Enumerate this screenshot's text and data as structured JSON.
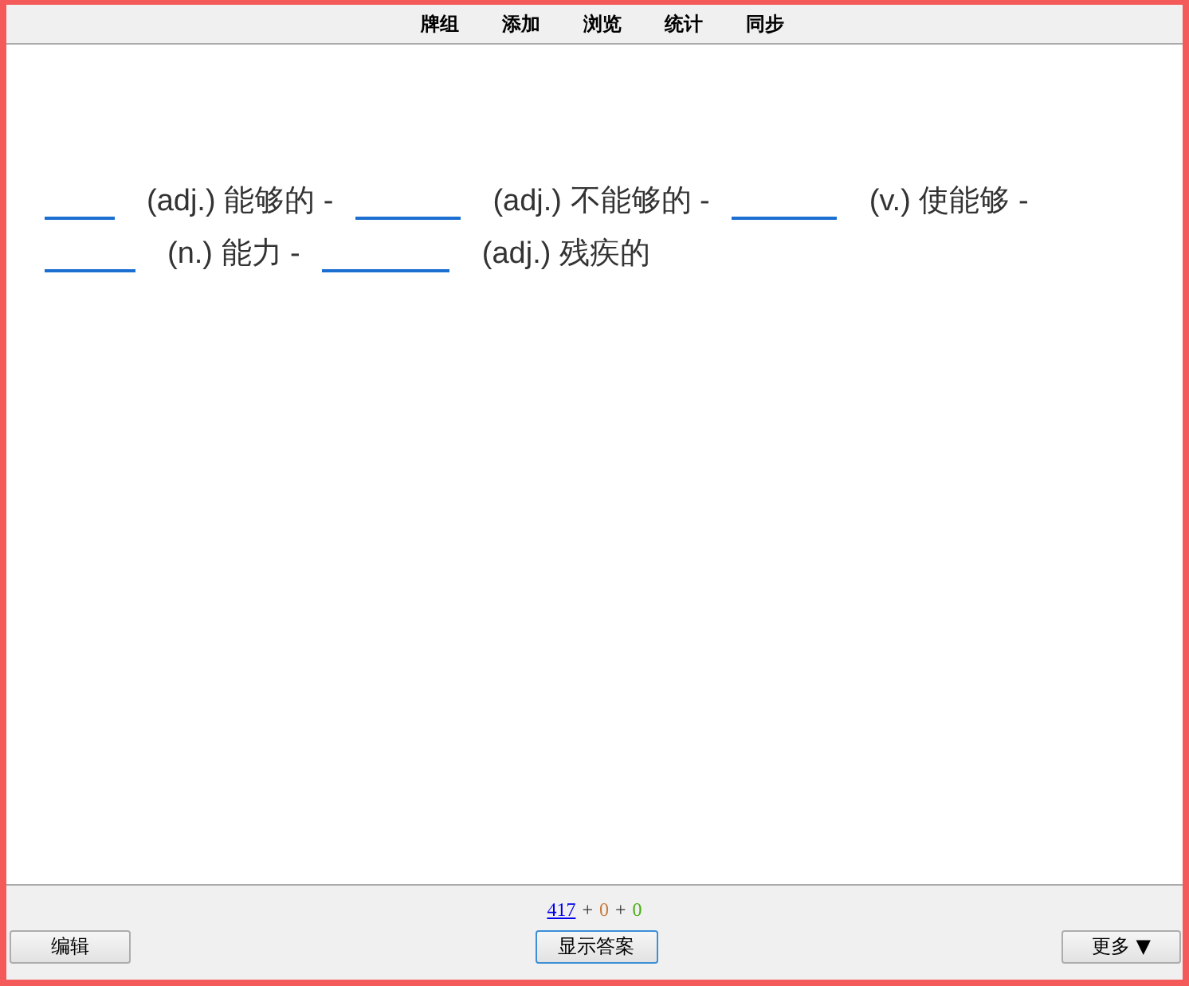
{
  "menu": [
    {
      "label": "牌组"
    },
    {
      "label": "添加"
    },
    {
      "label": "浏览"
    },
    {
      "label": "统计"
    },
    {
      "label": "同步"
    }
  ],
  "cloze": [
    {
      "kind": "blank"
    },
    {
      "kind": "hint",
      "text": "(adj.) 能够的 -"
    },
    {
      "kind": "blank"
    },
    {
      "kind": "hint",
      "text": "(adj.) 不能够的 -"
    },
    {
      "kind": "blank"
    },
    {
      "kind": "hint",
      "text": "(v.) 使能够 -"
    },
    {
      "kind": "blank"
    },
    {
      "kind": "hint",
      "text": "(n.) 能力 -"
    },
    {
      "kind": "blank"
    },
    {
      "kind": "hint",
      "text": "(adj.) 残疾的"
    }
  ],
  "counts": [
    {
      "kind": "link",
      "text": "417",
      "color": "#0000ee"
    },
    {
      "kind": "sep",
      "text": "+"
    },
    {
      "kind": "count",
      "text": "0",
      "color": "#c87b3d"
    },
    {
      "kind": "sep",
      "text": "+"
    },
    {
      "kind": "count",
      "text": "0",
      "color": "#4caf14"
    }
  ],
  "buttons": {
    "edit": "编辑",
    "show_answer": "显示答案",
    "more": "更多 ▼"
  }
}
